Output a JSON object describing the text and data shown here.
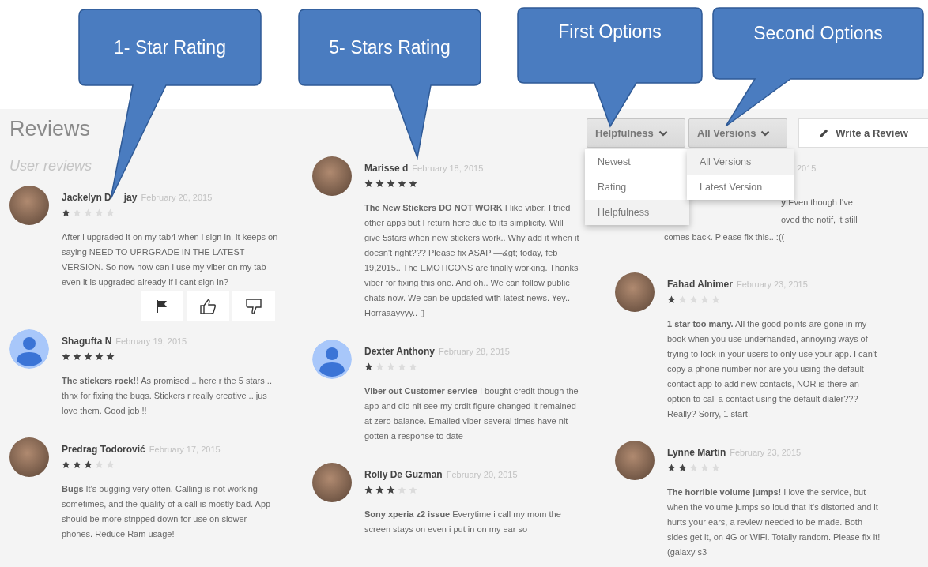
{
  "callouts": [
    {
      "label": "1- Star Rating"
    },
    {
      "label": "5- Stars Rating"
    },
    {
      "label": "First Options"
    },
    {
      "label": "Second Options"
    }
  ],
  "header": {
    "title": "Reviews",
    "sort": {
      "label": "Helpfulness",
      "options": [
        {
          "label": "Newest",
          "selected": false
        },
        {
          "label": "Rating",
          "selected": false
        },
        {
          "label": "Helpfulness",
          "selected": true
        }
      ]
    },
    "version": {
      "label": "All Versions",
      "options": [
        {
          "label": "All Versions",
          "selected": true
        },
        {
          "label": "Latest Version",
          "selected": false
        }
      ]
    },
    "write_button": "Write a Review"
  },
  "columns": [
    {
      "heading": "User reviews",
      "reviews": [
        {
          "kind": "full",
          "avatar_photo": true,
          "name": "Jackelyn D",
          "name_end": "jay",
          "date": "February 20, 2015",
          "stars": 1,
          "body": "After i upgraded it on my tab4 when i sign in, it keeps on saying NEED TO UPRGRADE IN THE LATEST VERSION. So now how can i use my viber on my tab even it is upgraded already if i cant sign in?",
          "show_actions": true
        },
        {
          "kind": "full",
          "avatar_photo": false,
          "name": "Shagufta N",
          "date": "February 19, 2015",
          "stars": 5,
          "body": "**The stickers rock!!** As promised .. here r the 5 stars .. thnx for fixing the bugs. Stickers r really creative .. jus love them. Good job !!",
          "show_actions": false
        },
        {
          "kind": "full",
          "avatar_photo": true,
          "name": "Predrag Todorović",
          "date": "February 17, 2015",
          "stars": 3,
          "body": "**Bugs** It's bugging very often. Calling is not working sometimes, and the quality of a call is mostly bad. App should be more stripped down for use on slower phones. Reduce Ram usage!",
          "show_actions": false
        }
      ]
    },
    {
      "reviews": [
        {
          "kind": "full",
          "avatar_photo": true,
          "name": "Marisse d",
          "date": "February 18, 2015",
          "stars": 5,
          "body": "**The New Stickers DO NOT WORK** I like viber. I tried other apps but I return here due to its simplicity. Will give 5stars when new stickers work.. Why add it when it doesn't right??? Please fix ASAP —&gt; today, feb 19,2015.. The EMOTICONS are finally working. Thanks viber for fixing this one. And oh.. We can follow public chats now. We can be updated with latest news. Yey.. Horraaayyyy.. ▯",
          "show_actions": false
        },
        {
          "kind": "full",
          "avatar_photo": false,
          "name": "Dexter Anthony",
          "date": "February 28, 2015",
          "stars": 1,
          "body": "**Viber out Customer service** I bought credit though the app and did nit see my crdit figure changed it remained at zero balance. Emailed viber several times have nit gotten a response to date",
          "show_actions": false
        },
        {
          "kind": "full",
          "avatar_photo": true,
          "name": "Rolly De Guzman",
          "date": "February 20, 2015",
          "stars": 3,
          "body": "**Sony xperia z2 issue** Everytime i call my mom the screen stays on even i put in on my ear so",
          "show_actions": false
        }
      ]
    },
    {
      "reviews": [
        {
          "kind": "partial",
          "date": "2015",
          "lines": [
            {
              "text": "**y** Even though I've",
              "indented": true
            },
            {
              "text": "oved the notif, it still",
              "indented": true
            },
            {
              "text": "comes back. Please fix this.. :((",
              "indented": false
            }
          ]
        },
        {
          "kind": "full",
          "avatar_photo": true,
          "name": "Fahad Alnimer",
          "date": "February 23, 2015",
          "stars": 1,
          "body": "**1 star too many.** All the good points are gone in my book when you use underhanded, annoying ways of trying to lock in your users to only use your app. I can't copy a phone number nor are you using the default contact app to add new contacts, NOR is there an option to call a contact using the default dialer??? Really? Sorry, 1 start.",
          "show_actions": false
        },
        {
          "kind": "full",
          "avatar_photo": true,
          "name": "Lynne Martin",
          "date": "February 23, 2015",
          "stars": 2,
          "body": "**The horrible volume jumps!** I love the service, but when the volume jumps so loud that it's distorted and it hurts your ears, a review needed to be made. Both sides get it, on 4G or WiFi. Totally random. Please fix it! (galaxy s3",
          "show_actions": false
        }
      ]
    }
  ]
}
